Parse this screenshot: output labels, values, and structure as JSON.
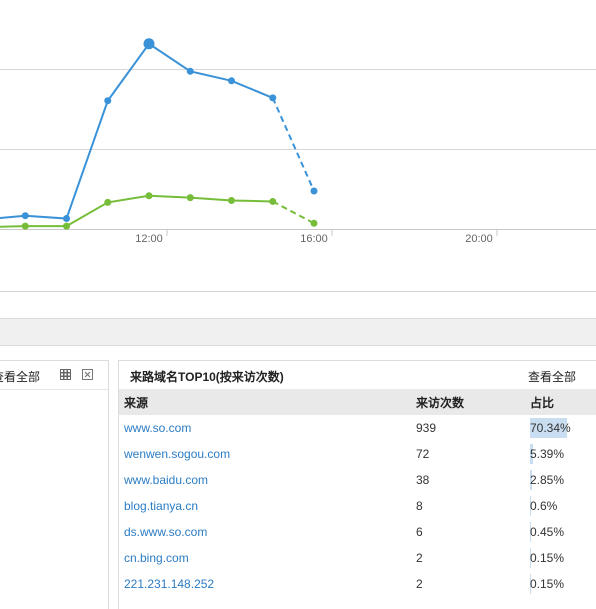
{
  "chart_data": {
    "type": "line",
    "x_ticks": [
      "12:00",
      "16:00",
      "20:00"
    ],
    "series": [
      {
        "color": "#3a92d8",
        "points": [
          {
            "x": "08:00",
            "y": 10
          },
          {
            "x": "09:00",
            "y": 14
          },
          {
            "x": "10:00",
            "y": 11
          },
          {
            "x": "11:00",
            "y": 135
          },
          {
            "x": "12:00",
            "y": 195
          },
          {
            "x": "13:00",
            "y": 166
          },
          {
            "x": "14:00",
            "y": 156
          },
          {
            "x": "15:00",
            "y": 138
          },
          {
            "x": "16:00",
            "y": 40
          }
        ],
        "dashed_from": "15:00",
        "highlight": "12:00"
      },
      {
        "color": "#76bd3a",
        "points": [
          {
            "x": "08:00",
            "y": 2
          },
          {
            "x": "09:00",
            "y": 3
          },
          {
            "x": "10:00",
            "y": 3
          },
          {
            "x": "11:00",
            "y": 28
          },
          {
            "x": "12:00",
            "y": 35
          },
          {
            "x": "13:00",
            "y": 33
          },
          {
            "x": "14:00",
            "y": 30
          },
          {
            "x": "15:00",
            "y": 29
          },
          {
            "x": "16:00",
            "y": 6
          }
        ],
        "dashed_from": "15:00"
      }
    ]
  },
  "left_panel": {
    "view_all": "查看全部",
    "icons": [
      "grid-icon",
      "close-icon"
    ]
  },
  "referrer_panel": {
    "title": "来路域名TOP10(按来访次数)",
    "view_all": "查看全部",
    "columns": [
      "来源",
      "来访次数",
      "占比"
    ],
    "rows": [
      {
        "domain": "www.so.com",
        "visits": "939",
        "share": "70.34%",
        "share_value": 70.34
      },
      {
        "domain": "wenwen.sogou.com",
        "visits": "72",
        "share": "5.39%",
        "share_value": 5.39
      },
      {
        "domain": "www.baidu.com",
        "visits": "38",
        "share": "2.85%",
        "share_value": 2.85
      },
      {
        "domain": "blog.tianya.cn",
        "visits": "8",
        "share": "0.6%",
        "share_value": 0.6
      },
      {
        "domain": "ds.www.so.com",
        "visits": "6",
        "share": "0.45%",
        "share_value": 0.45
      },
      {
        "domain": "cn.bing.com",
        "visits": "2",
        "share": "0.15%",
        "share_value": 0.15
      },
      {
        "domain": "221.231.148.252",
        "visits": "2",
        "share": "0.15%",
        "share_value": 0.15
      }
    ]
  }
}
